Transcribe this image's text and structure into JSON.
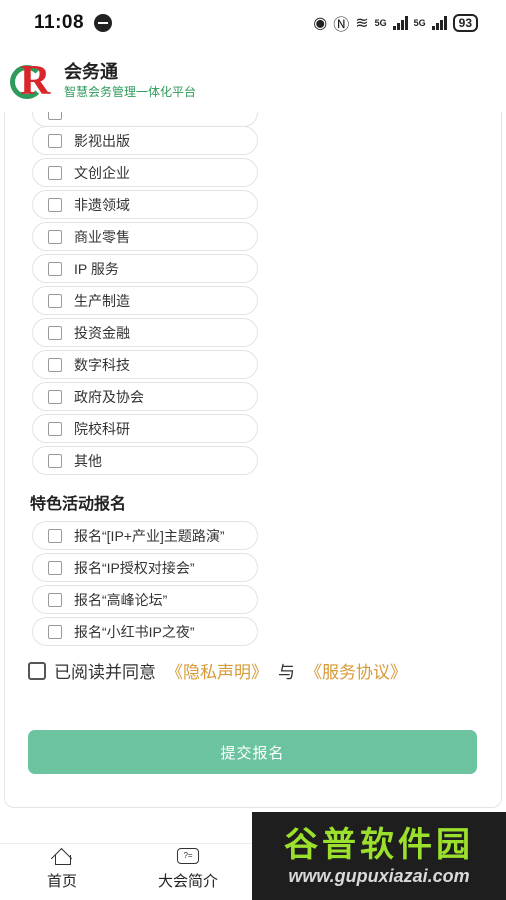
{
  "status_bar": {
    "time": "11:08",
    "network_1": "5G",
    "network_2": "5G",
    "battery": "93"
  },
  "header": {
    "logo_letter": "R",
    "app_name": "会务通",
    "subtitle": "智慧会务管理一体化平台"
  },
  "industry_options": [
    {
      "label": "影视出版",
      "checked": false
    },
    {
      "label": "文创企业",
      "checked": false
    },
    {
      "label": "非遗领域",
      "checked": false
    },
    {
      "label": "商业零售",
      "checked": false
    },
    {
      "label": "IP 服务",
      "checked": false
    },
    {
      "label": "生产制造",
      "checked": false
    },
    {
      "label": "投资金融",
      "checked": false
    },
    {
      "label": "数字科技",
      "checked": false
    },
    {
      "label": "政府及协会",
      "checked": false
    },
    {
      "label": "院校科研",
      "checked": false
    },
    {
      "label": "其他",
      "checked": false
    }
  ],
  "activities": {
    "title": "特色活动报名",
    "options": [
      {
        "label": "报名“[IP+产业]主题路演”",
        "checked": false
      },
      {
        "label": "报名“IP授权对接会”",
        "checked": false
      },
      {
        "label": "报名“高峰论坛”",
        "checked": false
      },
      {
        "label": "报名“小红书IP之夜”",
        "checked": false
      }
    ]
  },
  "agreement": {
    "checked": false,
    "text": "已阅读并同意",
    "privacy_link": "《隐私声明》",
    "and_text": "与",
    "service_link": "《服务协议》"
  },
  "submit_label": "提交报名",
  "tabbar": {
    "home": "首页",
    "intro": "大会简介"
  },
  "watermark": {
    "title": "谷普软件园",
    "url": "www.gupuxiazai.com"
  },
  "colors": {
    "accent_green": "#6cc3a0",
    "brand_green": "#2f9a5c",
    "link_gold": "#d79a37",
    "logo_red": "#d8262a"
  }
}
